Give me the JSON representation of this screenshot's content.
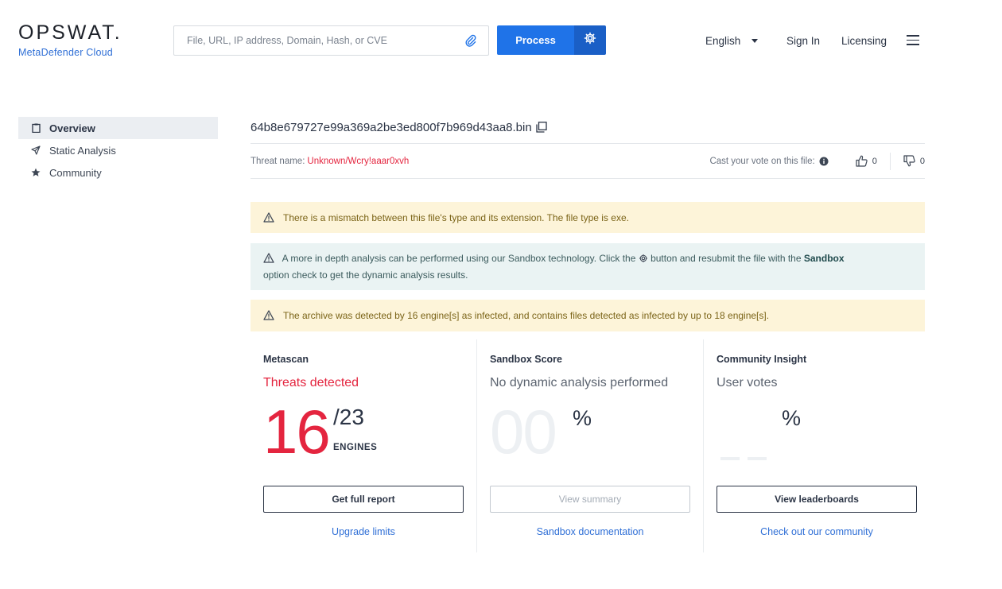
{
  "header": {
    "logo_main": "OPSWAT.",
    "logo_sub": "MetaDefender Cloud",
    "search_placeholder": "File, URL, IP address, Domain, Hash, or CVE",
    "process_label": "Process",
    "language": "English",
    "signin": "Sign In",
    "licensing": "Licensing"
  },
  "sidebar": {
    "items": [
      {
        "label": "Overview",
        "icon": "clipboard-icon",
        "active": true
      },
      {
        "label": "Static Analysis",
        "icon": "send-icon",
        "active": false
      },
      {
        "label": "Community",
        "icon": "star-icon",
        "active": false
      }
    ]
  },
  "file": {
    "name": "64b8e679727e99a369a2be3ed800f7b969d43aa8.bin",
    "threat_label": "Threat name:",
    "threat_name": "Unknown/Wcry!aaar0xvh",
    "vote_label": "Cast your vote on this file:",
    "upvotes": "0",
    "downvotes": "0"
  },
  "alerts": {
    "mismatch": "There is a mismatch between this file's type and its extension. The file type is exe.",
    "sandbox_part1": "A more in depth analysis can be performed using our Sandbox technology. Click the",
    "sandbox_part2": "button and resubmit the file with the",
    "sandbox_bold": "Sandbox",
    "sandbox_part3": "option check to get the dynamic analysis results.",
    "archive": "The archive was detected by 16 engine[s] as infected, and contains files detected as infected by up to 18 engine[s]."
  },
  "cards": {
    "metascan": {
      "title": "Metascan",
      "status": "Threats detected",
      "detected": "16",
      "total": "/23",
      "engines_label": "ENGINES",
      "button": "Get full report",
      "link": "Upgrade limits"
    },
    "sandbox": {
      "title": "Sandbox Score",
      "status": "No dynamic analysis performed",
      "score": "00",
      "pct": "%",
      "button": "View summary",
      "link": "Sandbox documentation"
    },
    "community": {
      "title": "Community Insight",
      "status": "User votes",
      "pct": "%",
      "button": "View leaderboards",
      "link": "Check out our community"
    }
  },
  "colors": {
    "brand_blue": "#1f73e8",
    "threat_red": "#e4253f",
    "link_blue": "#2f6fd6",
    "warn_bg": "#fdf4d9",
    "info_bg": "#eaf3f3"
  }
}
